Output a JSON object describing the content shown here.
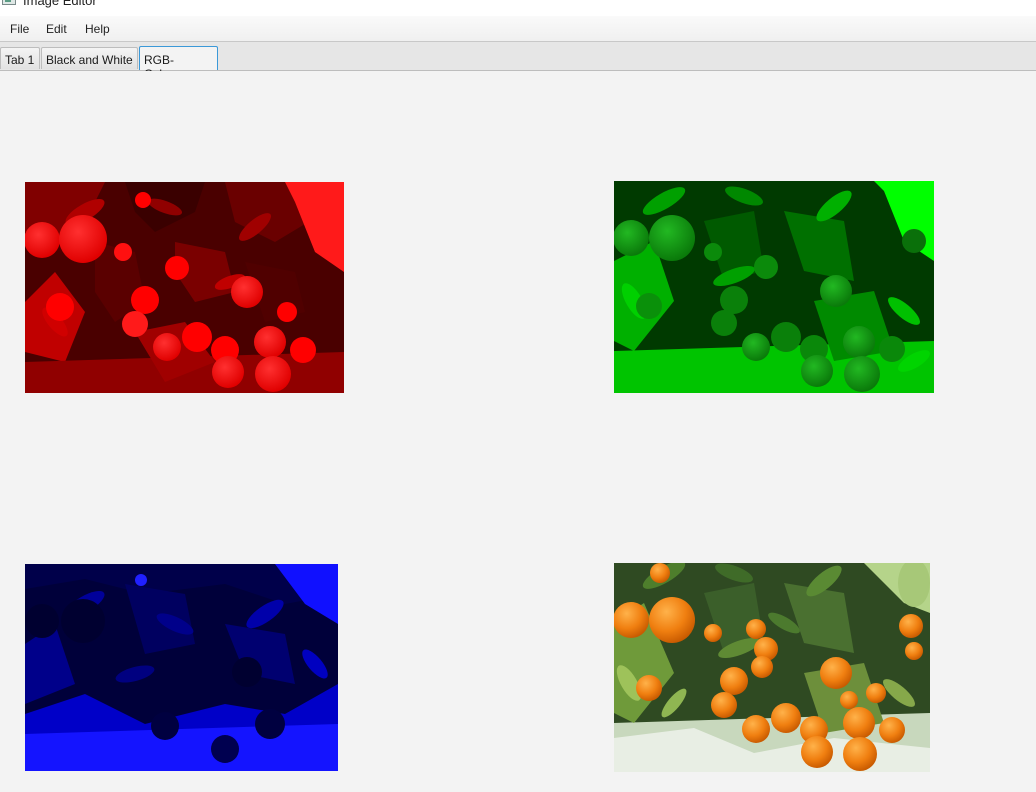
{
  "window": {
    "title": "Image Editor",
    "icon": "app-icon"
  },
  "menu": {
    "items": [
      {
        "label": "File"
      },
      {
        "label": "Edit"
      },
      {
        "label": "Help"
      }
    ]
  },
  "tabs": [
    {
      "label": "Tab 1",
      "selected": false
    },
    {
      "label": "Black and White",
      "selected": false
    },
    {
      "label": "RGB-Colours",
      "selected": true
    }
  ],
  "images": [
    {
      "name": "red-channel-image",
      "channel": "red",
      "main_color": "#ff0000"
    },
    {
      "name": "green-channel-image",
      "channel": "green",
      "main_color": "#00e000"
    },
    {
      "name": "blue-channel-image",
      "channel": "blue",
      "main_color": "#0000ff"
    },
    {
      "name": "original-color-image",
      "channel": "original",
      "main_color": "#f08a1a"
    }
  ],
  "colors": {
    "window_bg": "#f3f3f3",
    "tab_selected_border": "#3b99d8"
  }
}
